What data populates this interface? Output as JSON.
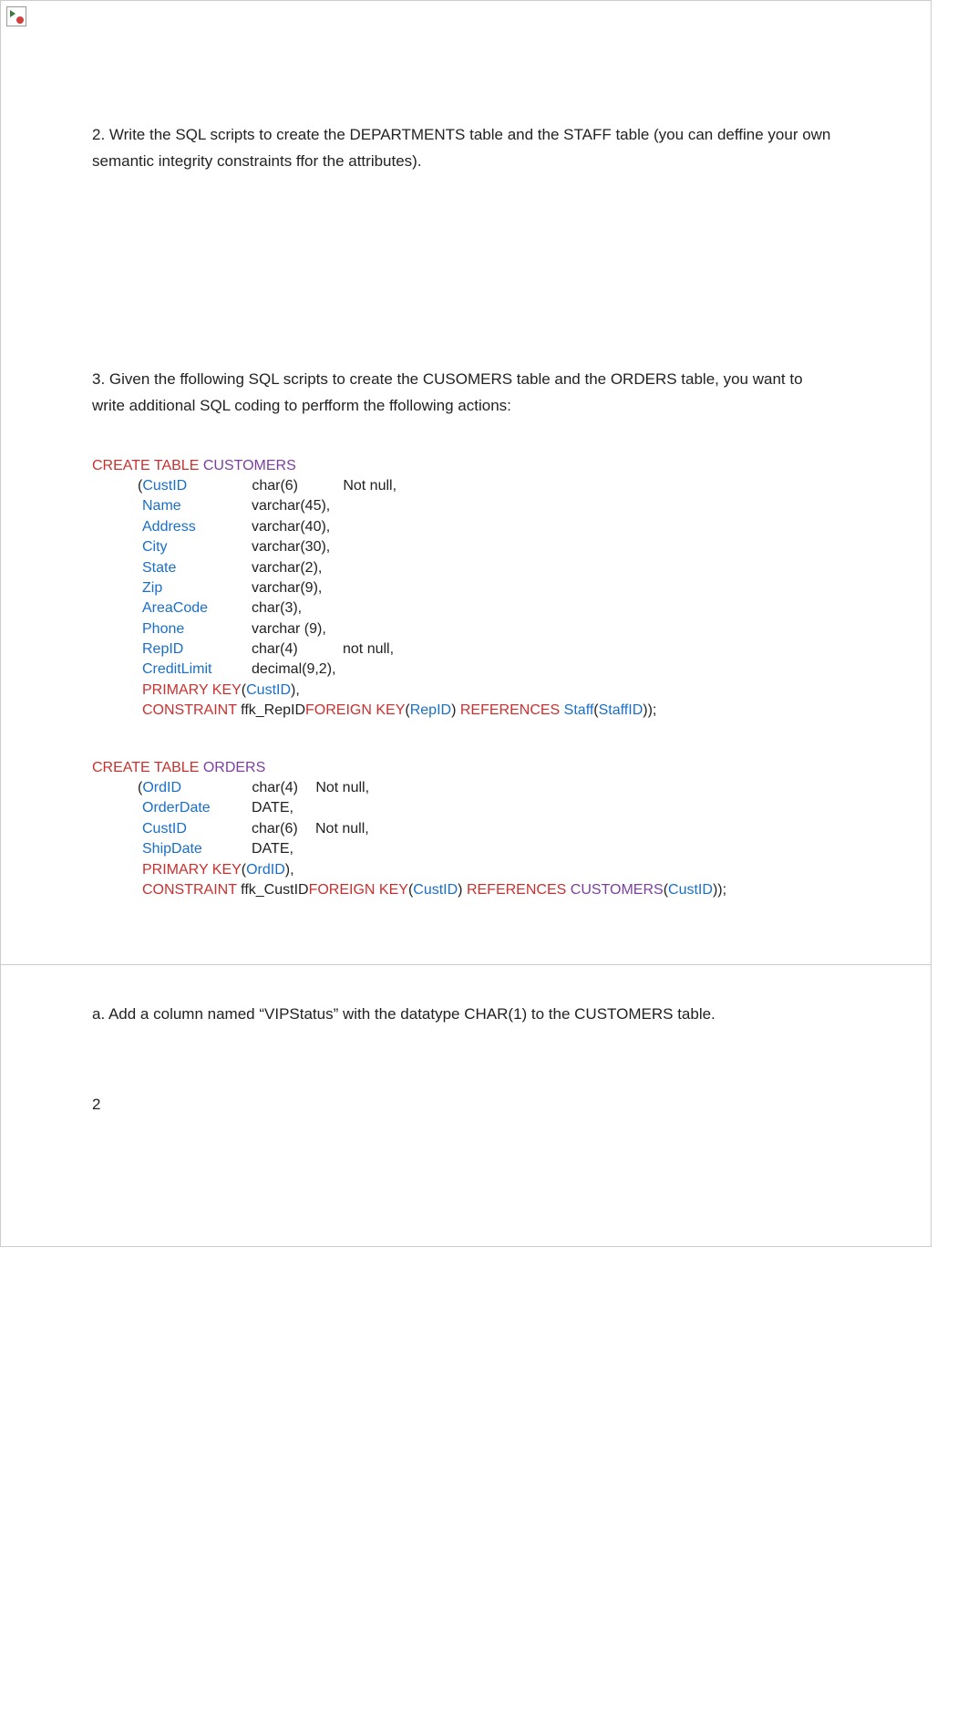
{
  "question2": "2. Write the SQL scripts to create the DEPARTMENTS table and the STAFF table (you can deffine your own semantic integrity constraints ffor the attributes).",
  "question3": "3. Given the ffollowing SQL scripts to create the CUSOMERS table and the ORDERS table, you want to write additional SQL coding to perfform the ffollowing actions:",
  "sql1": {
    "create": "CREATE TABLE",
    "tableName": "CUSTOMERS",
    "cols": [
      {
        "open": "(",
        "name": "CustID",
        "type": "char(6)",
        "extra": "Not null,"
      },
      {
        "open": "",
        "name": "Name",
        "type": "varchar(45),",
        "extra": ""
      },
      {
        "open": "",
        "name": "Address",
        "type": "varchar(40),",
        "extra": ""
      },
      {
        "open": "",
        "name": "City",
        "type": "varchar(30),",
        "extra": ""
      },
      {
        "open": "",
        "name": "State",
        "type": "varchar(2),",
        "extra": ""
      },
      {
        "open": "",
        "name": "Zip",
        "type": "varchar(9),",
        "extra": ""
      },
      {
        "open": "",
        "name": "AreaCode",
        "type": "char(3),",
        "extra": ""
      },
      {
        "open": "",
        "name": "Phone",
        "type": "varchar (9),",
        "extra": ""
      },
      {
        "open": "",
        "name": "RepID",
        "type": "char(4)",
        "extra": "not null,"
      },
      {
        "open": "",
        "name": "CreditLimit",
        "type": "decimal(9,2),",
        "extra": ""
      }
    ],
    "pk": {
      "label": "PRIMARY KEY",
      "open": "(",
      "col": "CustID",
      "close": "),"
    },
    "constraint": {
      "label": "CONSTRAINT",
      "name": "ffk_RepID",
      "fk": "FOREIGN KEY",
      "open": "(",
      "fkcol": "RepID",
      "close": ")",
      "ref": "REFERENCES",
      "reftable": "Staff",
      "refopen": "(",
      "refcol": "StaffID",
      "refclose": "));"
    }
  },
  "sql2": {
    "create": "CREATE TABLE",
    "tableName": "ORDERS",
    "cols": [
      {
        "open": "(",
        "name": "OrdID",
        "type": "char(4)",
        "extra": "Not null,"
      },
      {
        "open": "",
        "name": "OrderDate",
        "type": "DATE,",
        "extra": ""
      },
      {
        "open": "",
        "name": "CustID",
        "type": "char(6)",
        "extra": "Not null,"
      },
      {
        "open": "",
        "name": "ShipDate",
        "type": "DATE,",
        "extra": ""
      }
    ],
    "pk": {
      "label": "PRIMARY KEY",
      "open": "(",
      "col": "OrdID",
      "close": "),"
    },
    "constraint": {
      "label": "CONSTRAINT",
      "name": "ffk_CustID",
      "fk": "FOREIGN KEY",
      "open": "(",
      "fkcol": "CustID",
      "close": ")",
      "ref": "REFERENCES",
      "reftable": "CUSTOMERS",
      "refopen": "(",
      "refcol": "CustID",
      "refclose": "));"
    }
  },
  "subA": "a. Add a column named “VIPStatus” with the datatype CHAR(1) to the CUSTOMERS table.",
  "pageNumber": "2"
}
